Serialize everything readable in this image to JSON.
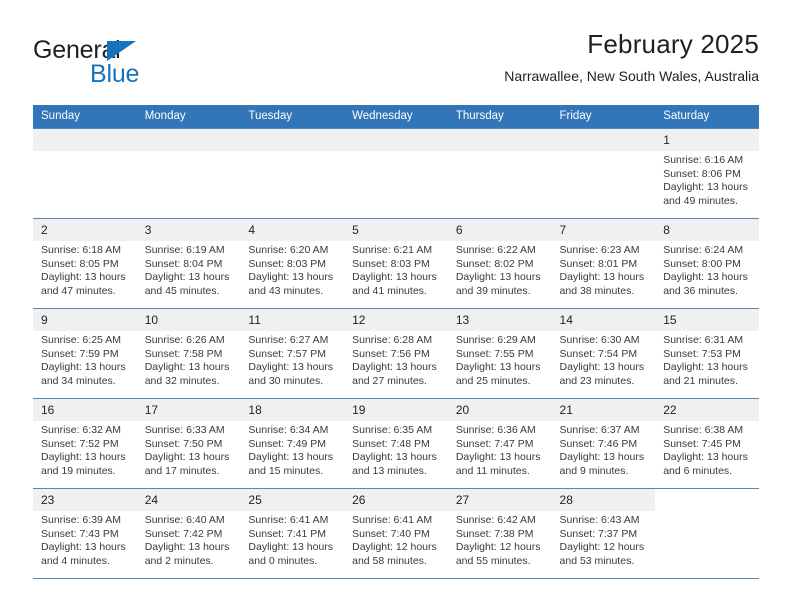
{
  "brand": {
    "name_primary": "General",
    "name_secondary": "Blue",
    "logo_icon": "triangle-logo-icon"
  },
  "header": {
    "title": "February 2025",
    "location": "Narrawallee, New South Wales, Australia"
  },
  "calendar": {
    "weekday_headers": [
      "Sunday",
      "Monday",
      "Tuesday",
      "Wednesday",
      "Thursday",
      "Friday",
      "Saturday"
    ],
    "accent_color": "#3275b8",
    "daynum_band_color": "#f0f0f0",
    "grid_line_color": "#5b85ad",
    "weeks": [
      [
        {
          "blank": true
        },
        {
          "blank": true
        },
        {
          "blank": true
        },
        {
          "blank": true
        },
        {
          "blank": true
        },
        {
          "blank": true
        },
        {
          "day": "1",
          "sunrise": "Sunrise: 6:16 AM",
          "sunset": "Sunset: 8:06 PM",
          "daylight_line1": "Daylight: 13 hours",
          "daylight_line2": "and 49 minutes."
        }
      ],
      [
        {
          "day": "2",
          "sunrise": "Sunrise: 6:18 AM",
          "sunset": "Sunset: 8:05 PM",
          "daylight_line1": "Daylight: 13 hours",
          "daylight_line2": "and 47 minutes."
        },
        {
          "day": "3",
          "sunrise": "Sunrise: 6:19 AM",
          "sunset": "Sunset: 8:04 PM",
          "daylight_line1": "Daylight: 13 hours",
          "daylight_line2": "and 45 minutes."
        },
        {
          "day": "4",
          "sunrise": "Sunrise: 6:20 AM",
          "sunset": "Sunset: 8:03 PM",
          "daylight_line1": "Daylight: 13 hours",
          "daylight_line2": "and 43 minutes."
        },
        {
          "day": "5",
          "sunrise": "Sunrise: 6:21 AM",
          "sunset": "Sunset: 8:03 PM",
          "daylight_line1": "Daylight: 13 hours",
          "daylight_line2": "and 41 minutes."
        },
        {
          "day": "6",
          "sunrise": "Sunrise: 6:22 AM",
          "sunset": "Sunset: 8:02 PM",
          "daylight_line1": "Daylight: 13 hours",
          "daylight_line2": "and 39 minutes."
        },
        {
          "day": "7",
          "sunrise": "Sunrise: 6:23 AM",
          "sunset": "Sunset: 8:01 PM",
          "daylight_line1": "Daylight: 13 hours",
          "daylight_line2": "and 38 minutes."
        },
        {
          "day": "8",
          "sunrise": "Sunrise: 6:24 AM",
          "sunset": "Sunset: 8:00 PM",
          "daylight_line1": "Daylight: 13 hours",
          "daylight_line2": "and 36 minutes."
        }
      ],
      [
        {
          "day": "9",
          "sunrise": "Sunrise: 6:25 AM",
          "sunset": "Sunset: 7:59 PM",
          "daylight_line1": "Daylight: 13 hours",
          "daylight_line2": "and 34 minutes."
        },
        {
          "day": "10",
          "sunrise": "Sunrise: 6:26 AM",
          "sunset": "Sunset: 7:58 PM",
          "daylight_line1": "Daylight: 13 hours",
          "daylight_line2": "and 32 minutes."
        },
        {
          "day": "11",
          "sunrise": "Sunrise: 6:27 AM",
          "sunset": "Sunset: 7:57 PM",
          "daylight_line1": "Daylight: 13 hours",
          "daylight_line2": "and 30 minutes."
        },
        {
          "day": "12",
          "sunrise": "Sunrise: 6:28 AM",
          "sunset": "Sunset: 7:56 PM",
          "daylight_line1": "Daylight: 13 hours",
          "daylight_line2": "and 27 minutes."
        },
        {
          "day": "13",
          "sunrise": "Sunrise: 6:29 AM",
          "sunset": "Sunset: 7:55 PM",
          "daylight_line1": "Daylight: 13 hours",
          "daylight_line2": "and 25 minutes."
        },
        {
          "day": "14",
          "sunrise": "Sunrise: 6:30 AM",
          "sunset": "Sunset: 7:54 PM",
          "daylight_line1": "Daylight: 13 hours",
          "daylight_line2": "and 23 minutes."
        },
        {
          "day": "15",
          "sunrise": "Sunrise: 6:31 AM",
          "sunset": "Sunset: 7:53 PM",
          "daylight_line1": "Daylight: 13 hours",
          "daylight_line2": "and 21 minutes."
        }
      ],
      [
        {
          "day": "16",
          "sunrise": "Sunrise: 6:32 AM",
          "sunset": "Sunset: 7:52 PM",
          "daylight_line1": "Daylight: 13 hours",
          "daylight_line2": "and 19 minutes."
        },
        {
          "day": "17",
          "sunrise": "Sunrise: 6:33 AM",
          "sunset": "Sunset: 7:50 PM",
          "daylight_line1": "Daylight: 13 hours",
          "daylight_line2": "and 17 minutes."
        },
        {
          "day": "18",
          "sunrise": "Sunrise: 6:34 AM",
          "sunset": "Sunset: 7:49 PM",
          "daylight_line1": "Daylight: 13 hours",
          "daylight_line2": "and 15 minutes."
        },
        {
          "day": "19",
          "sunrise": "Sunrise: 6:35 AM",
          "sunset": "Sunset: 7:48 PM",
          "daylight_line1": "Daylight: 13 hours",
          "daylight_line2": "and 13 minutes."
        },
        {
          "day": "20",
          "sunrise": "Sunrise: 6:36 AM",
          "sunset": "Sunset: 7:47 PM",
          "daylight_line1": "Daylight: 13 hours",
          "daylight_line2": "and 11 minutes."
        },
        {
          "day": "21",
          "sunrise": "Sunrise: 6:37 AM",
          "sunset": "Sunset: 7:46 PM",
          "daylight_line1": "Daylight: 13 hours",
          "daylight_line2": "and 9 minutes."
        },
        {
          "day": "22",
          "sunrise": "Sunrise: 6:38 AM",
          "sunset": "Sunset: 7:45 PM",
          "daylight_line1": "Daylight: 13 hours",
          "daylight_line2": "and 6 minutes."
        }
      ],
      [
        {
          "day": "23",
          "sunrise": "Sunrise: 6:39 AM",
          "sunset": "Sunset: 7:43 PM",
          "daylight_line1": "Daylight: 13 hours",
          "daylight_line2": "and 4 minutes."
        },
        {
          "day": "24",
          "sunrise": "Sunrise: 6:40 AM",
          "sunset": "Sunset: 7:42 PM",
          "daylight_line1": "Daylight: 13 hours",
          "daylight_line2": "and 2 minutes."
        },
        {
          "day": "25",
          "sunrise": "Sunrise: 6:41 AM",
          "sunset": "Sunset: 7:41 PM",
          "daylight_line1": "Daylight: 13 hours",
          "daylight_line2": "and 0 minutes."
        },
        {
          "day": "26",
          "sunrise": "Sunrise: 6:41 AM",
          "sunset": "Sunset: 7:40 PM",
          "daylight_line1": "Daylight: 12 hours",
          "daylight_line2": "and 58 minutes."
        },
        {
          "day": "27",
          "sunrise": "Sunrise: 6:42 AM",
          "sunset": "Sunset: 7:38 PM",
          "daylight_line1": "Daylight: 12 hours",
          "daylight_line2": "and 55 minutes."
        },
        {
          "day": "28",
          "sunrise": "Sunrise: 6:43 AM",
          "sunset": "Sunset: 7:37 PM",
          "daylight_line1": "Daylight: 12 hours",
          "daylight_line2": "and 53 minutes."
        },
        {
          "blank": true
        }
      ]
    ]
  }
}
